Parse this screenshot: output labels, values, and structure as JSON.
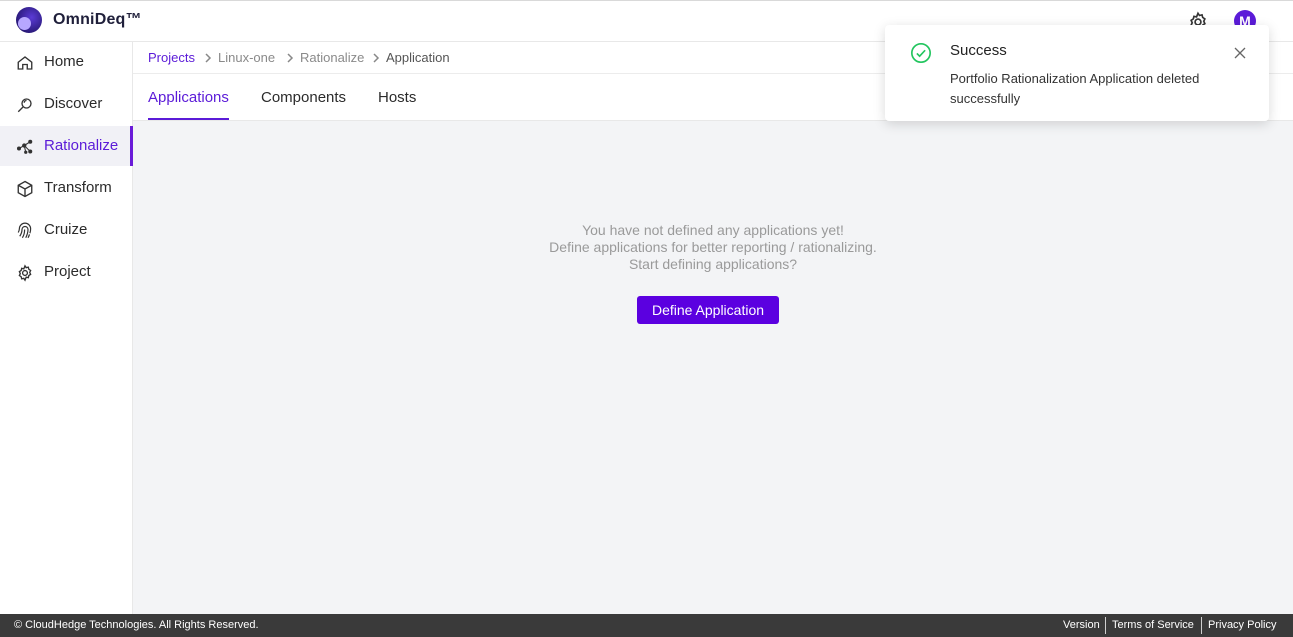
{
  "app": {
    "brand": "OmniDeq™",
    "avatar_initial": "M",
    "accent": "#5b1bd8"
  },
  "topbar": {
    "settings_icon": "gear-icon",
    "avatar_icon": "user-avatar"
  },
  "sidebar": {
    "items": [
      {
        "label": "Home",
        "icon": "home-icon"
      },
      {
        "label": "Discover",
        "icon": "search-icon"
      },
      {
        "label": "Rationalize",
        "icon": "rationalize-icon",
        "active": true
      },
      {
        "label": "Transform",
        "icon": "cube-icon"
      },
      {
        "label": "Cruize",
        "icon": "fingerprint-icon"
      },
      {
        "label": "Project",
        "icon": "gear-icon"
      }
    ]
  },
  "breadcrumb": {
    "items": [
      "Projects",
      "Linux-one",
      "Rationalize",
      "Application"
    ]
  },
  "tabs": {
    "items": [
      "Applications",
      "Components",
      "Hosts"
    ],
    "active": "Applications"
  },
  "empty_state": {
    "line1": "You have not defined any applications yet!",
    "line2": "Define applications for better reporting / rationalizing.",
    "line3": "Start defining applications?",
    "button": "Define Application"
  },
  "toast": {
    "title": "Success",
    "message": "Portfolio Rationalization Application deleted successfully",
    "status_color": "#22c55e"
  },
  "footer": {
    "copyright": "© CloudHedge Technologies. All Rights Reserved.",
    "links": [
      "Version",
      "Terms of Service",
      "Privacy Policy"
    ]
  }
}
